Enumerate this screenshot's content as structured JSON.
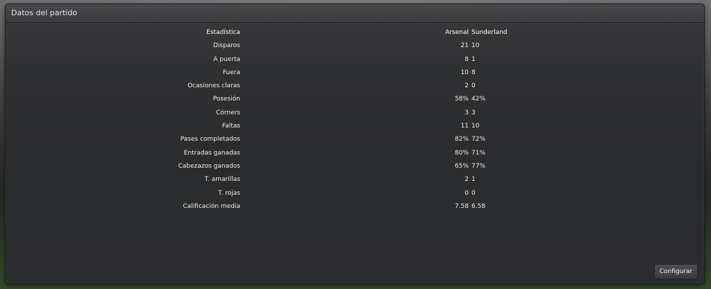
{
  "panel": {
    "title": "Datos del partido",
    "configure_label": "Configurar"
  },
  "table": {
    "header": {
      "label": "Estadística",
      "home": "Arsenal",
      "away": "Sunderland"
    },
    "rows": [
      {
        "label": "Disparos",
        "home": "21",
        "away": "10"
      },
      {
        "label": "A puerta",
        "home": "8",
        "away": "1"
      },
      {
        "label": "Fuera",
        "home": "10",
        "away": "8"
      },
      {
        "label": "Ocasiones claras",
        "home": "2",
        "away": "0"
      },
      {
        "label": "Posesión",
        "home": "58%",
        "away": "42%"
      },
      {
        "label": "Córners",
        "home": "3",
        "away": "3"
      },
      {
        "label": "Faltas",
        "home": "11",
        "away": "10"
      },
      {
        "label": "Pases completados",
        "home": "82%",
        "away": "72%"
      },
      {
        "label": "Entradas ganadas",
        "home": "80%",
        "away": "71%"
      },
      {
        "label": "Cabezazos ganados",
        "home": "65%",
        "away": "77%"
      },
      {
        "label": "T. amarillas",
        "home": "2",
        "away": "1"
      },
      {
        "label": "T. rojas",
        "home": "0",
        "away": "0"
      },
      {
        "label": "Calificación media",
        "home": "7.58",
        "away": "6.58"
      }
    ]
  }
}
